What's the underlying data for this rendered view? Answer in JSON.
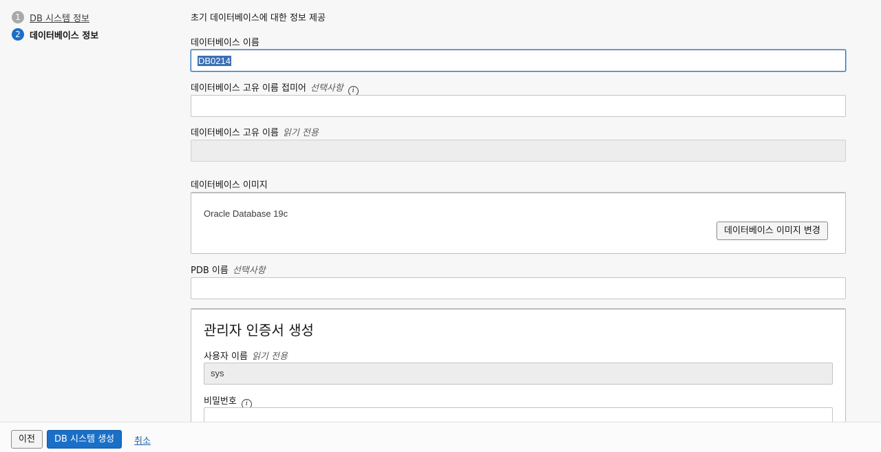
{
  "steps": [
    {
      "number": "1",
      "label": "DB 시스템 정보"
    },
    {
      "number": "2",
      "label": "데이터베이스 정보"
    }
  ],
  "intro": "초기 데이터베이스에 대한 정보 제공",
  "fields": {
    "db_name": {
      "label": "데이터베이스 이름",
      "value": "DB0214"
    },
    "unique_suffix": {
      "label": "데이터베이스 고유 이름 접미어",
      "hint": "선택사항",
      "value": ""
    },
    "unique_name": {
      "label": "데이터베이스 고유 이름",
      "hint": "읽기 전용",
      "value": ""
    },
    "image": {
      "label": "데이터베이스 이미지",
      "value": "Oracle Database 19c",
      "change_button": "데이터베이스 이미지 변경"
    },
    "pdb_name": {
      "label": "PDB 이름",
      "hint": "선택사항",
      "value": ""
    }
  },
  "admin": {
    "title": "관리자 인증서 생성",
    "username_label": "사용자 이름",
    "username_hint": "읽기 전용",
    "username_value": "sys",
    "password_label": "비밀번호",
    "password_value": ""
  },
  "footer": {
    "previous": "이전",
    "create": "DB 시스템 생성",
    "cancel": "취소"
  },
  "icons": {
    "info": "i"
  }
}
